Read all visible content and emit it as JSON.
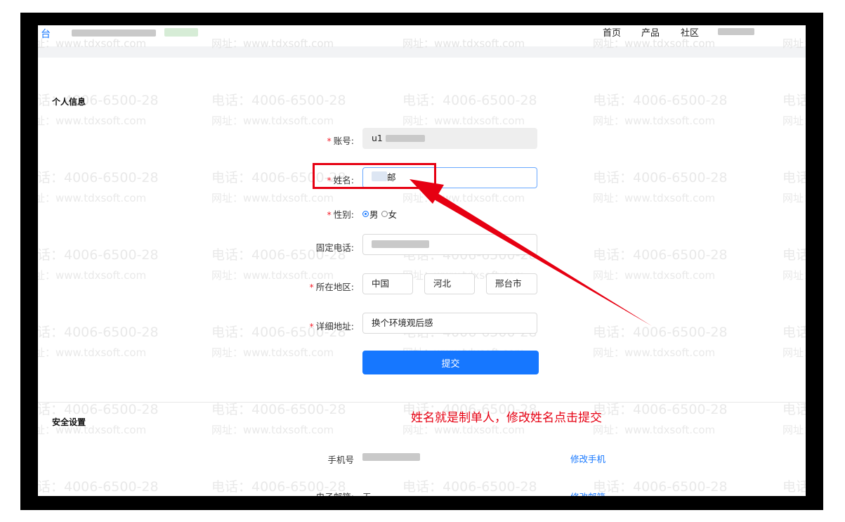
{
  "header": {
    "brand": "台",
    "nav": [
      "首页",
      "产品",
      "社区"
    ]
  },
  "watermark": {
    "phone": "电话：4006-6500-28",
    "url": "网址：www.tdxsoft.com"
  },
  "profile": {
    "section_title": "个人信息",
    "account_label": "账号:",
    "account_value": "u1",
    "name_label": "姓名:",
    "name_value": "邮",
    "gender_label": "性别:",
    "gender_options": [
      "男",
      "女"
    ],
    "phone_label": "固定电话:",
    "region_label": "所在地区:",
    "region": [
      "中国",
      "河北",
      "邢台市"
    ],
    "address_label": "详细地址:",
    "address_value": "换个环境观后感",
    "submit_label": "提交"
  },
  "security": {
    "section_title": "安全设置",
    "mobile_label": "手机号",
    "change_mobile": "修改手机",
    "email_label": "电子邮箱:",
    "email_value": "无",
    "change_email": "修改邮箱"
  },
  "annotation": {
    "text": "姓名就是制单人，修改姓名点击提交",
    "color": "#e60012"
  },
  "colors": {
    "primary": "#1677ff",
    "required": "#f5222d"
  }
}
